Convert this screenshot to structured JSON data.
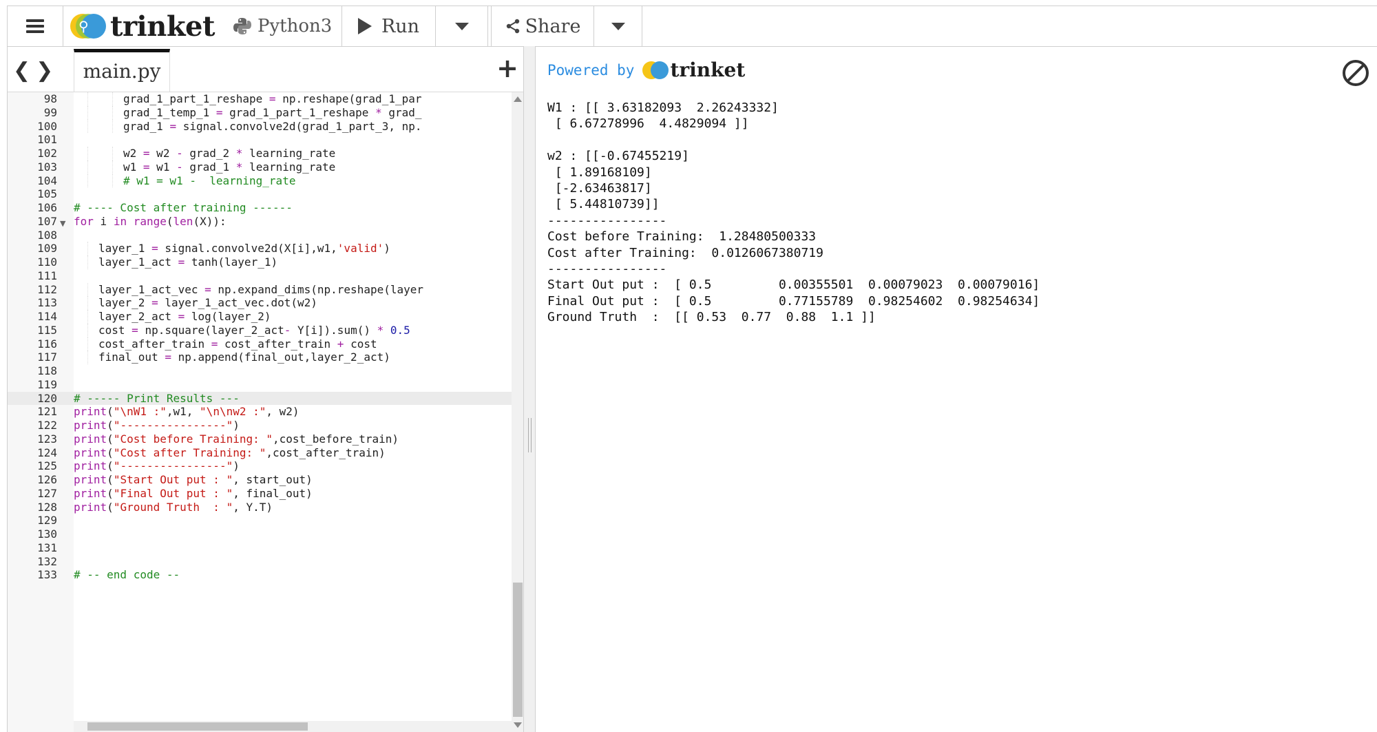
{
  "topbar": {
    "brand": "trinket",
    "language": "Python3",
    "run_label": "Run",
    "share_label": "Share"
  },
  "editor": {
    "tab": "main.py",
    "lines": [
      {
        "n": "98",
        "ind": 2,
        "html": "grad_1_part_1_reshape <span class='op'>=</span> np.reshape(grad_1_par"
      },
      {
        "n": "99",
        "ind": 2,
        "html": "grad_1_temp_1 <span class='op'>=</span> grad_1_part_1_reshape <span class='op'>*</span> grad_"
      },
      {
        "n": "100",
        "ind": 2,
        "html": "grad_1 <span class='op'>=</span> signal.convolve2d(grad_1_part_3, np."
      },
      {
        "n": "101",
        "ind": 0,
        "html": ""
      },
      {
        "n": "102",
        "ind": 2,
        "html": "w2 <span class='op'>=</span> w2 <span class='op'>-</span> grad_2 <span class='op'>*</span> learning_rate"
      },
      {
        "n": "103",
        "ind": 2,
        "html": "w1 <span class='op'>=</span> w1 <span class='op'>-</span> grad_1 <span class='op'>*</span> learning_rate"
      },
      {
        "n": "104",
        "ind": 2,
        "html": "<span class='cm'># w1 = w1 -  learning_rate</span>"
      },
      {
        "n": "105",
        "ind": 0,
        "html": ""
      },
      {
        "n": "106",
        "ind": 0,
        "html": "<span class='cm'># ---- Cost after training ------</span>"
      },
      {
        "n": "107",
        "ind": 0,
        "fold": true,
        "html": "<span class='kw'>for</span> i <span class='kw'>in</span> <span class='kw'>range</span>(<span class='kw'>len</span>(X)):"
      },
      {
        "n": "108",
        "ind": 0,
        "html": ""
      },
      {
        "n": "109",
        "ind": 1,
        "html": "layer_1 <span class='op'>=</span> signal.convolve2d(X[i],w1,<span class='st'>'valid'</span>)"
      },
      {
        "n": "110",
        "ind": 1,
        "html": "layer_1_act <span class='op'>=</span> tanh(layer_1)"
      },
      {
        "n": "111",
        "ind": 0,
        "html": ""
      },
      {
        "n": "112",
        "ind": 1,
        "html": "layer_1_act_vec <span class='op'>=</span> np.expand_dims(np.reshape(layer"
      },
      {
        "n": "113",
        "ind": 1,
        "html": "layer_2 <span class='op'>=</span> layer_1_act_vec.dot(w2)"
      },
      {
        "n": "114",
        "ind": 1,
        "html": "layer_2_act <span class='op'>=</span> log(layer_2)"
      },
      {
        "n": "115",
        "ind": 1,
        "html": "cost <span class='op'>=</span> np.square(layer_2_act<span class='op'>-</span> Y[i]).sum() <span class='op'>*</span> <span class='nm'>0.5</span>"
      },
      {
        "n": "116",
        "ind": 1,
        "html": "cost_after_train <span class='op'>=</span> cost_after_train <span class='op'>+</span> cost"
      },
      {
        "n": "117",
        "ind": 1,
        "html": "final_out <span class='op'>=</span> np.append(final_out,layer_2_act)"
      },
      {
        "n": "118",
        "ind": 0,
        "html": ""
      },
      {
        "n": "119",
        "ind": 0,
        "html": ""
      },
      {
        "n": "120",
        "ind": 0,
        "active": true,
        "html": "<span class='cm'># ----- Print Results ---</span>"
      },
      {
        "n": "121",
        "ind": 0,
        "html": "<span class='kw'>print</span>(<span class='st'>\"\\nW1 :\"</span>,w1, <span class='st'>\"\\n\\nw2 :\"</span>, w2)"
      },
      {
        "n": "122",
        "ind": 0,
        "html": "<span class='kw'>print</span>(<span class='st'>\"----------------\"</span>)"
      },
      {
        "n": "123",
        "ind": 0,
        "html": "<span class='kw'>print</span>(<span class='st'>\"Cost before Training: \"</span>,cost_before_train)"
      },
      {
        "n": "124",
        "ind": 0,
        "html": "<span class='kw'>print</span>(<span class='st'>\"Cost after Training: \"</span>,cost_after_train)"
      },
      {
        "n": "125",
        "ind": 0,
        "html": "<span class='kw'>print</span>(<span class='st'>\"----------------\"</span>)"
      },
      {
        "n": "126",
        "ind": 0,
        "html": "<span class='kw'>print</span>(<span class='st'>\"Start Out put : \"</span>, start_out)"
      },
      {
        "n": "127",
        "ind": 0,
        "html": "<span class='kw'>print</span>(<span class='st'>\"Final Out put : \"</span>, final_out)"
      },
      {
        "n": "128",
        "ind": 0,
        "html": "<span class='kw'>print</span>(<span class='st'>\"Ground Truth  : \"</span>, Y.T)"
      },
      {
        "n": "129",
        "ind": 0,
        "html": ""
      },
      {
        "n": "130",
        "ind": 0,
        "html": ""
      },
      {
        "n": "131",
        "ind": 0,
        "html": ""
      },
      {
        "n": "132",
        "ind": 0,
        "html": ""
      },
      {
        "n": "133",
        "ind": 0,
        "html": "<span class='cm'># -- end code --</span>"
      }
    ]
  },
  "output": {
    "powered_by": "Powered by",
    "brand": "trinket",
    "lines": [
      "W1 : [[ 3.63182093  2.26243332]",
      " [ 6.67278996  4.4829094 ]]",
      "",
      "w2 : [[-0.67455219]",
      " [ 1.89168109]",
      " [-2.63463817]",
      " [ 5.44810739]]",
      "----------------",
      "Cost before Training:  1.28480500333",
      "Cost after Training:  0.0126067380719",
      "----------------",
      "Start Out put :  [ 0.5         0.00355501  0.00079023  0.00079016]",
      "Final Out put :  [ 0.5         0.77155789  0.98254602  0.98254634]",
      "Ground Truth  :  [[ 0.53  0.77  0.88  1.1 ]]"
    ]
  }
}
